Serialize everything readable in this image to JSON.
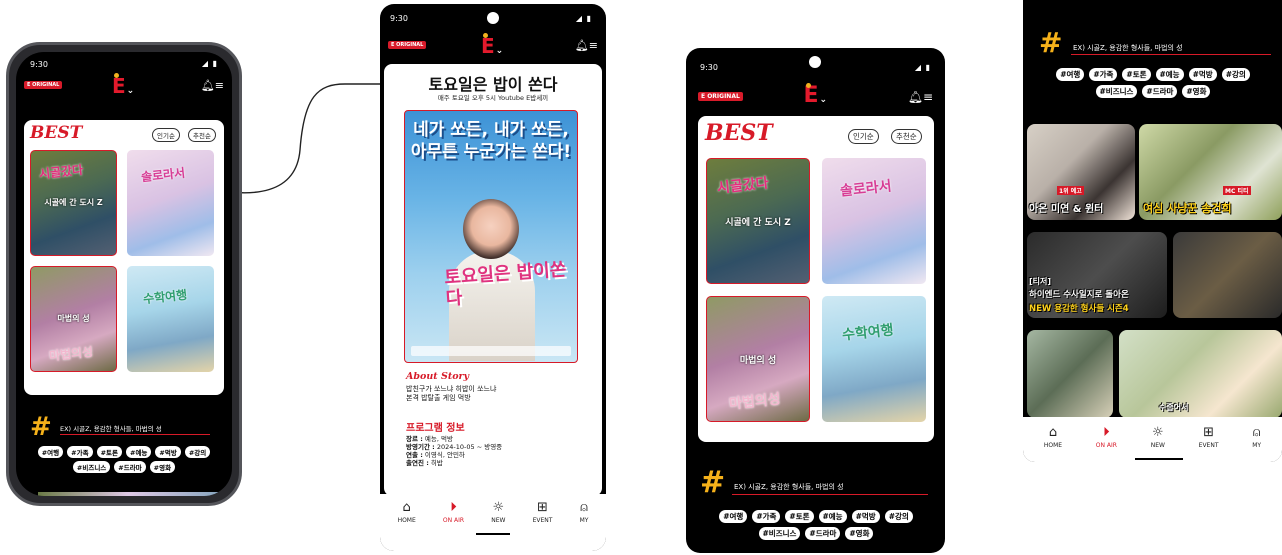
{
  "status": {
    "time": "9:30"
  },
  "brand": {
    "original_badge": "E ORIGINAL",
    "logo": "E"
  },
  "home": {
    "best_title": "BEST",
    "sort": [
      "인기순",
      "추천순"
    ],
    "programs": [
      {
        "label": "시골에 간 도시 Z",
        "poster_text": "시골갔다"
      },
      {
        "label": "",
        "poster_text": "솔로라서"
      },
      {
        "label": "마법의 성",
        "poster_text": "마법의성"
      },
      {
        "label": "",
        "poster_text": "수학여행"
      }
    ],
    "hashtag_symbol": "#",
    "search_placeholder": "EX) 시골Z, 용감한 형사들, 마법의 성",
    "tags": [
      "#여행",
      "#가족",
      "#토론",
      "#예능",
      "#먹방",
      "#강의",
      "#비즈니스",
      "#드라마",
      "#영화"
    ]
  },
  "detail": {
    "title": "토요일은 밥이 쏜다",
    "subtitle": "매주 토요일 오후 5시 Youtube E밥세끼",
    "poster_headline": "네가 쏘든, 내가 쏘든, 아무튼 누군가는 쏜다!",
    "poster_title": "토요일은 밥이쏜다",
    "about_heading": "About Story",
    "about_lines": [
      "밥친구가 쏘느냐 히밥이 쏘느냐",
      "본격 밥탈출 게임 먹방"
    ],
    "info_heading": "프로그램 정보",
    "info": [
      {
        "k": "장르 :",
        "v": " 예능, 먹방"
      },
      {
        "k": "방영기간 :",
        "v": " 2024-10-05 ~ 방영중"
      },
      {
        "k": "연출 :",
        "v": " 이영식, 안민하"
      },
      {
        "k": "출연진 :",
        "v": " 히밥"
      }
    ]
  },
  "nav": [
    {
      "label": "HOME",
      "icon": "home-icon"
    },
    {
      "label": "ON AIR",
      "icon": "play-icon"
    },
    {
      "label": "NEW",
      "icon": "bulb-icon"
    },
    {
      "label": "EVENT",
      "icon": "gift-icon"
    },
    {
      "label": "MY",
      "icon": "user-icon"
    }
  ],
  "event": {
    "videos": [
      {
        "caption_top": "1위 예고",
        "caption": "아온 미연 & 윈터"
      },
      {
        "caption_top": "MC 티티",
        "caption": "여심 사냥꾼 송건희"
      },
      {
        "caption_top": "[티저]",
        "caption": "하이엔드 수사일지로 돌아온"
      },
      {
        "caption_top": "",
        "caption": "NEW 용감한 형사들 시즌4"
      },
      {
        "caption_top": "",
        "caption": ""
      },
      {
        "caption_top": "",
        "caption": "수줍어서"
      }
    ]
  },
  "colors": {
    "accent": "#d71a28",
    "hash": "#f5b11a",
    "background": "#000000"
  }
}
